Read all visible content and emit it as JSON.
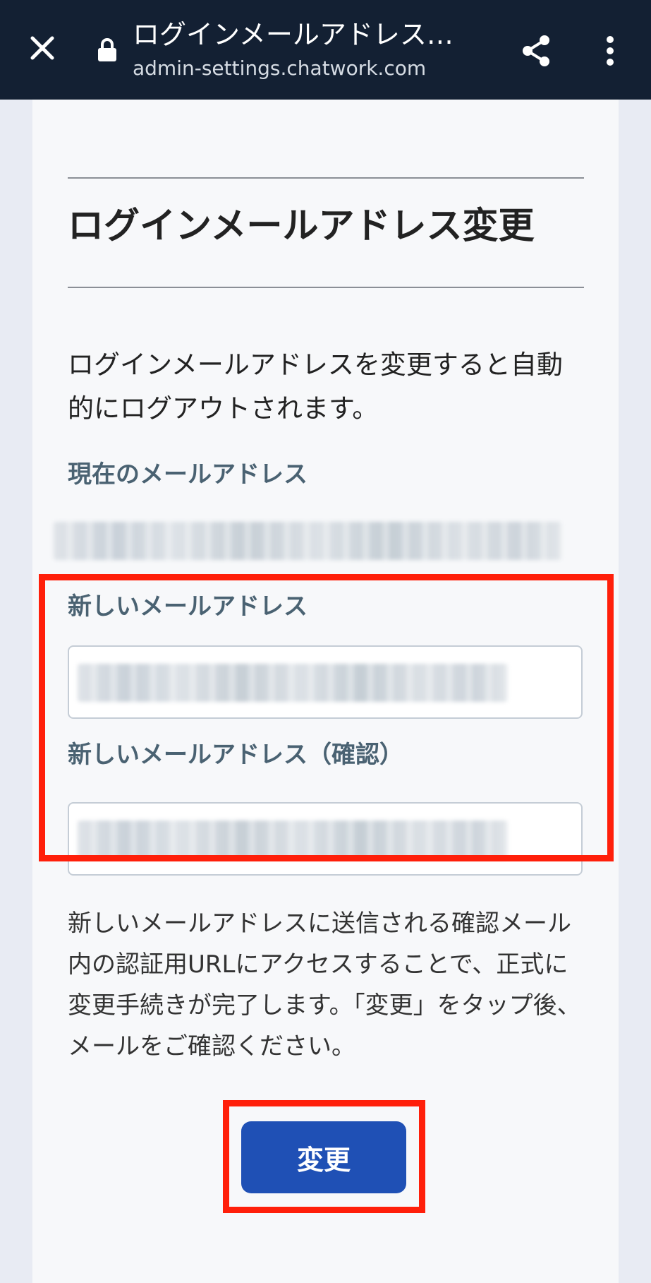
{
  "browser": {
    "title": "ログインメールアドレス…",
    "url": "admin-settings.chatwork.com",
    "icons": [
      "close-icon",
      "lock-icon",
      "share-icon",
      "more-vert-icon"
    ]
  },
  "page": {
    "heading": "ログインメールアドレス変更",
    "intro": "ログインメールアドレスを変更すると自動的にログアウトされます。",
    "current_email_label": "現在のメールアドレス",
    "new_email_label": "新しいメールアドレス",
    "confirm_email_label": "新しいメールアドレス（確認）",
    "notice": "新しいメールアドレスに送信される確認メール内の認証用URLにアクセスすることで、正式に変更手続きが完了します。「変更」をタップ後、メールをご確認ください。",
    "submit_label": "変更"
  },
  "colors": {
    "topbar": "#132033",
    "label": "#4a6272",
    "button": "#1f50b5",
    "highlight": "#ff1f0a"
  }
}
